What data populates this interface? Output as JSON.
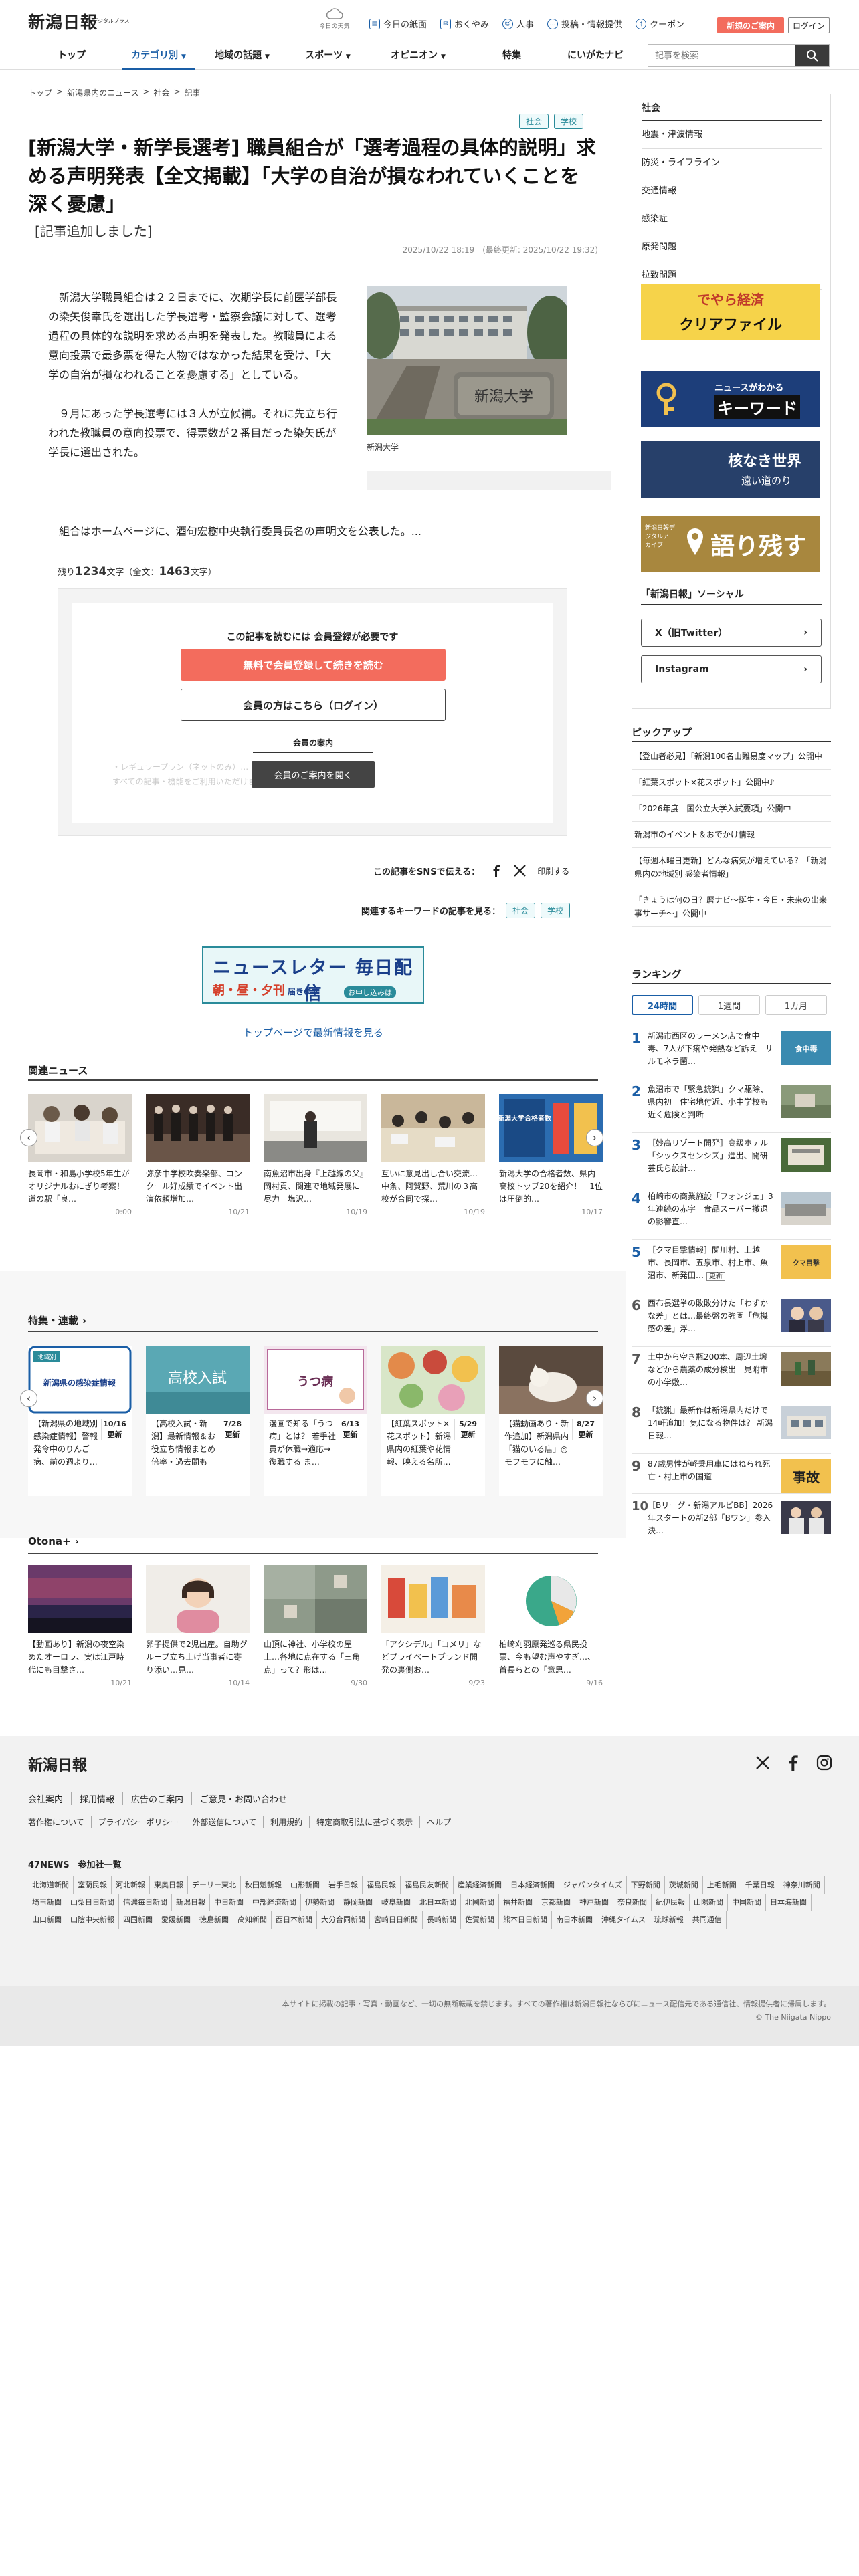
{
  "header": {
    "logo": "新潟日報",
    "logo_sub": "デジタルプラス",
    "weather": "今日の天気",
    "links": [
      "今日の紙面",
      "おくやみ",
      "人事",
      "投稿・情報提供",
      "クーポン"
    ],
    "register": "新規のご案内",
    "login": "ログイン"
  },
  "nav": {
    "items": [
      "トップ",
      "カテゴリ別",
      "地域の話題",
      "スポーツ",
      "オピニオン",
      "特集",
      "にいがたナビ"
    ],
    "search_placeholder": "記事を検索"
  },
  "breadcrumb": [
    "トップ",
    ">",
    "新潟県内のニュース",
    ">",
    "社会",
    ">",
    "記事"
  ],
  "article": {
    "tags": [
      "社会",
      "学校"
    ],
    "title": "[新潟大学・新学長選考] 職員組合が「選考過程の具体的説明」求める声明発表【全文掲載】「大学の自治が損なわれていくことを深く憂慮」",
    "subtitle": "[記事追加しました]",
    "dates": "2025/10/22 18:19　(最終更新: 2025/10/22 19:32)",
    "paragraphs": [
      "新潟大学職員組合は２２日までに、次期学長に前医学部長の染矢俊幸氏を選出した学長選考・監察会議に対して、選考過程の具体的な説明を求める声明を発表した。教職員による意向投票で最多票を得た人物ではなかった結果を受け、「大学の自治が損なわれることを憂慮する」としている。",
      "９月にあった学長選考には３人が立候補。それに先立ち行われた教職員の意向投票で、得票数が２番目だった染矢氏が学長に選出された。"
    ],
    "last_paragraph": "組合はホームページに、酒句宏樹中央執行委員長名の声明文を公表した。...",
    "photo_caption": "新潟大学",
    "photo_sign": "新潟大学",
    "remain_label": "残り",
    "remain_count": "1234",
    "remain_unit": "文字（全文：",
    "total_count": "1463",
    "total_unit": "文字）"
  },
  "paywall": {
    "title": "この記事を読むには 会員登録が必要です",
    "btn_register": "無料で会員登録して続きを読む",
    "btn_login": "会員の方はこちら（ログイン）",
    "guide": "会員の案内",
    "faded1": "・レギュラープラン（ネットのみ）…",
    "faded2": "すべての記事・機能をご利用いただけます",
    "btn_guide": "会員のご案内を開く"
  },
  "share": {
    "label": "この記事をSNSで伝える：",
    "print": "印刷する"
  },
  "keywords": {
    "label": "関連するキーワードの記事を見る：",
    "tags": [
      "社会",
      "学校"
    ]
  },
  "newsletter": {
    "title": "ニュースレター 毎日配信",
    "sub": "朝・昼・夕刊",
    "note": "お申し込みは",
    "more": "届きます"
  },
  "top_link": "トップページで最新情報を見る",
  "related": {
    "heading": "関連ニュース",
    "items": [
      {
        "text": "長岡市・和島小学校5年生がオリジナルおにぎり考案！道の駅「良…",
        "date": "0:00"
      },
      {
        "text": "弥彦中学校吹奏楽部、コンクール好成績でイベント出演依頼増加…",
        "date": "10/21"
      },
      {
        "text": "南魚沼市出身『上越線の父』岡村貢、関連で地域発展に尽力　塩沢…",
        "date": "10/19"
      },
      {
        "text": "互いに意見出し合い交流…中条、阿賀野、荒川の３高校が合同で探…",
        "date": "10/19"
      },
      {
        "text": "新潟大学の合格者数、県内高校トップ20を紹介！　1位は圧倒的…",
        "date": "10/17"
      }
    ],
    "thumb_label": "新潟大学合格者数"
  },
  "features": {
    "heading": "特集・連載",
    "update_label": "更新",
    "items": [
      {
        "text": "【新潟県の地域別感染症情報】警報発令中のりんご病、前の週より…",
        "date": "10/16",
        "badge": "地域別",
        "thumb_title": "新潟県の感染症情報"
      },
      {
        "text": "【高校入試・新潟】最新情報＆お役立ち情報まとめ　倍率・過去問も",
        "date": "7/28",
        "thumb_title": "高校入試"
      },
      {
        "text": "漫画で知る「うつ病」とは？ 若手社員が休職→適応→復職する ま…",
        "date": "6/13",
        "thumb_title": "うつ病"
      },
      {
        "text": "【紅葉スポット×花スポット】新潟県内の紅葉や花情報、映える名所…",
        "date": "5/29"
      },
      {
        "text": "【猫動画あり・新作追加】新潟県内「猫のいる店」◎モフモフに触…",
        "date": "8/27"
      }
    ]
  },
  "otona": {
    "heading": "Otona+",
    "items": [
      {
        "text": "【動画あり】新潟の夜空染めたオーロラ、実は江戸時代にも目撃さ…",
        "date": "10/21"
      },
      {
        "text": "卵子提供で2児出産。自助グループ立ち上げ当事者に寄り添い…見…",
        "date": "10/14"
      },
      {
        "text": "山頂に神社、小学校の屋上…各地に点在する「三角点」って？形は…",
        "date": "9/30"
      },
      {
        "text": "「アクシデル」「コメリ」などプライベートブランド開発の裏側お…",
        "date": "9/23"
      },
      {
        "text": "柏崎刈羽原発巡る県民投票、今も望む声やすぎ…、首長らとの「意思…",
        "date": "9/16"
      }
    ]
  },
  "sidebar": {
    "heading": "社会",
    "items": [
      "地震・津波情報",
      "防災・ライフライン",
      "交通情報",
      "感染症",
      "原発問題",
      "拉致問題"
    ],
    "ads": [
      {
        "title": "でやら経済",
        "sub": "クリアファイル"
      },
      {
        "title": "ニュースがわかる",
        "sub": "キーワード"
      },
      {
        "title": "核なき世界",
        "sub": "遠い道のり"
      },
      {
        "title": "新潟日報デジタルアーカイブ",
        "sub": "語り残す"
      }
    ],
    "social_heading": "「新潟日報」ソーシャル",
    "social": [
      "X（旧Twitter）",
      "Instagram"
    ]
  },
  "pickup": {
    "heading": "ピックアップ",
    "items": [
      "【登山者必見】「新潟100名山難易度マップ」公開中",
      "「紅葉スポット×花スポット」公開中♪",
      "「2026年度　国公立大学入試要項」公開中",
      "新潟市のイベント＆おでかけ情報",
      "【毎週木曜日更新】どんな病気が増えている？「新潟県内の地域別 感染者情報」",
      "「きょうは何の日？暦ナビ〜誕生・今日・未来の出来事サーチ〜」公開中"
    ]
  },
  "ranking": {
    "heading": "ランキング",
    "tabs": [
      "24時間",
      "1週間",
      "1カ月"
    ],
    "items": [
      {
        "num": "1",
        "text": "新潟市西区のラーメン店で食中毒、7人が下痢や発熱など訴え　サルモネラ菌…"
      },
      {
        "num": "2",
        "text": "魚沼市で「緊急銃猟」クマ駆除、県内初　住宅地付近、小中学校も近く危険と判断"
      },
      {
        "num": "3",
        "text": "［妙高リゾート開発］高級ホテル「シックスセンシズ」進出、開研芸氏ら設計…"
      },
      {
        "num": "4",
        "text": "柏崎市の商業施設「フォンジェ」3年連続の赤字　食品スーパー撤退の影響直…"
      },
      {
        "num": "5",
        "text": "［クマ目撃情報］関川村、上越市、長岡市、五泉市、村上市、魚沼市、新発田…",
        "badge": "更新"
      },
      {
        "num": "6",
        "text": "西布長選挙の敗敗分けた「わずかな差」とは…最終盤の強固「危機感の差」浮…"
      },
      {
        "num": "7",
        "text": "土中から空き瓶200本、周辺土壌などから農薬の成分検出　見附市の小学敷…"
      },
      {
        "num": "8",
        "text": "「銃猟」最新作は新潟県内だけで14軒追加！気になる物件は？ 新潟日報…"
      },
      {
        "num": "9",
        "text": "87歳男性が軽乗用車にはねられ死亡・村上市の国道"
      },
      {
        "num": "10",
        "text": "［Bリーグ・新潟アルビBB］2026年スタートの新2部「Bワン」参入決…"
      }
    ],
    "thumb_labels": {
      "t1": "食中毒",
      "t5": "クマ目撃",
      "t9": "事故"
    }
  },
  "footer": {
    "logo": "新潟日報",
    "links": [
      "会社案内",
      "採用情報",
      "広告のご案内",
      "ご意見・お問い合わせ"
    ],
    "links2": [
      "著作権について",
      "プライバシーポリシー",
      "外部送信について",
      "利用規約",
      "特定商取引法に基づく表示",
      "ヘルプ"
    ],
    "news47": "47NEWS　参加社一覧",
    "papers": [
      "北海道新聞",
      "室蘭民報",
      "河北新報",
      "東奥日報",
      "デーリー東北",
      "秋田魁新報",
      "山形新聞",
      "岩手日報",
      "福島民報",
      "福島民友新聞",
      "産業経済新聞",
      "日本経済新聞",
      "ジャパンタイムズ",
      "下野新聞",
      "茨城新聞",
      "上毛新聞",
      "千葉日報",
      "神奈川新聞",
      "埼玉新聞",
      "山梨日日新聞",
      "信濃毎日新聞",
      "新潟日報",
      "中日新聞",
      "中部経済新聞",
      "伊勢新聞",
      "静岡新聞",
      "岐阜新聞",
      "北日本新聞",
      "北國新聞",
      "福井新聞",
      "京都新聞",
      "神戸新聞",
      "奈良新聞",
      "紀伊民報",
      "山陽新聞",
      "中国新聞",
      "日本海新聞",
      "山口新聞",
      "山陰中央新報",
      "四国新聞",
      "愛媛新聞",
      "徳島新聞",
      "高知新聞",
      "西日本新聞",
      "大分合同新聞",
      "宮崎日日新聞",
      "長崎新聞",
      "佐賀新聞",
      "熊本日日新聞",
      "南日本新聞",
      "沖縄タイムス",
      "琉球新報",
      "共同通信"
    ],
    "copy": "本サイトに掲載の記事・写真・動画など、一切の無断転載を禁じます。すべての著作権は新潟日報社ならびにニュース配信元である通信社、情報提供者に帰属します。",
    "copy2": "© The Niigata Nippo"
  },
  "colors": {
    "accent": "#1a5ea6",
    "register": "#f36c5d",
    "tag": "#2a8b9a"
  }
}
